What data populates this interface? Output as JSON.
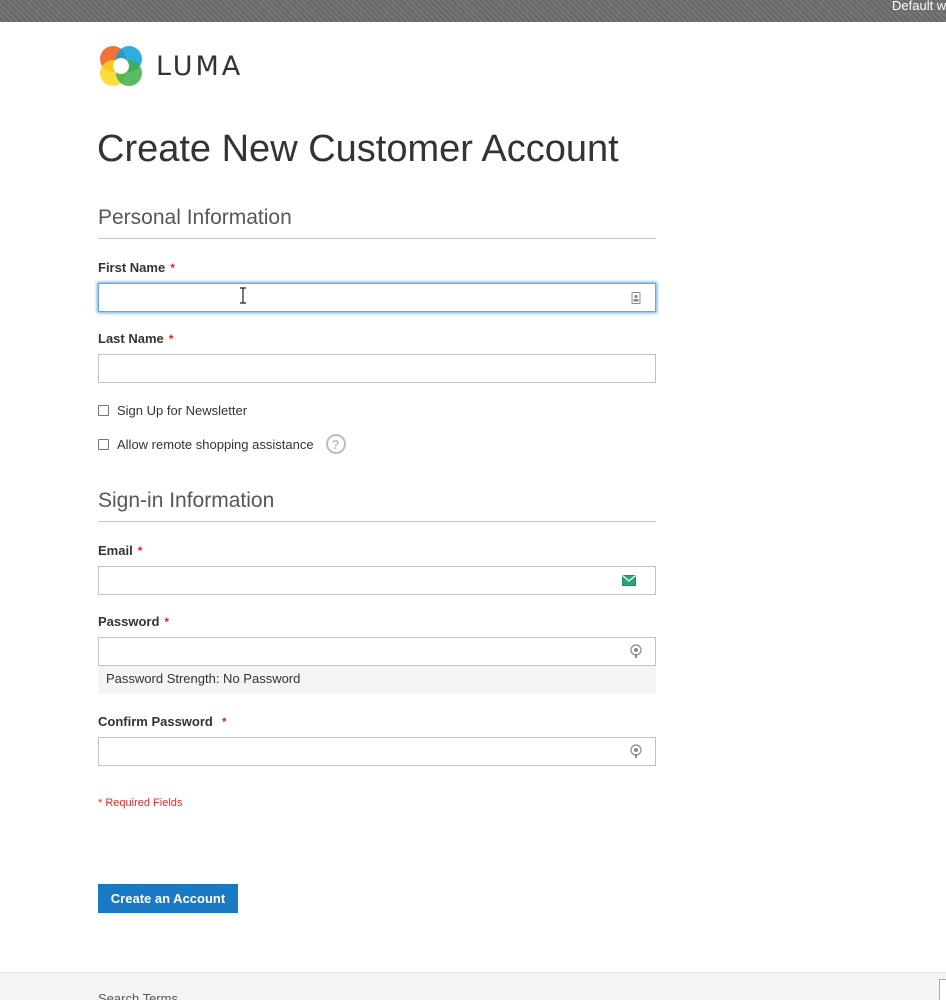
{
  "header": {
    "store_switcher": "Default welcome msg!",
    "logo_text": "LUMA"
  },
  "page": {
    "title": "Create New Customer Account"
  },
  "personal": {
    "section_title": "Personal Information",
    "first_name_label": "First Name",
    "first_name_value": "",
    "last_name_label": "Last Name",
    "last_name_value": "",
    "newsletter_label": "Sign Up for Newsletter",
    "newsletter_checked": false,
    "remote_assist_label": "Allow remote shopping assistance",
    "remote_assist_checked": false,
    "help_glyph": "?"
  },
  "signin": {
    "section_title": "Sign-in Information",
    "email_label": "Email",
    "email_value": "",
    "password_label": "Password",
    "password_value": "",
    "password_strength": "Password Strength: No Password",
    "confirm_label": "Confirm Password",
    "confirm_value": ""
  },
  "form": {
    "required_star": "*",
    "required_note": "* Required Fields",
    "submit_label": "Create an Account"
  },
  "footer": {
    "search_terms": "Search Terms"
  },
  "icons": {
    "first_name_icon": "contact-card-icon",
    "email_icon": "envelope-icon",
    "password_icon": "key-icon",
    "help_icon": "question-icon"
  },
  "colors": {
    "primary": "#1979c3",
    "required": "#e02b27",
    "focus": "#68a8e0"
  }
}
